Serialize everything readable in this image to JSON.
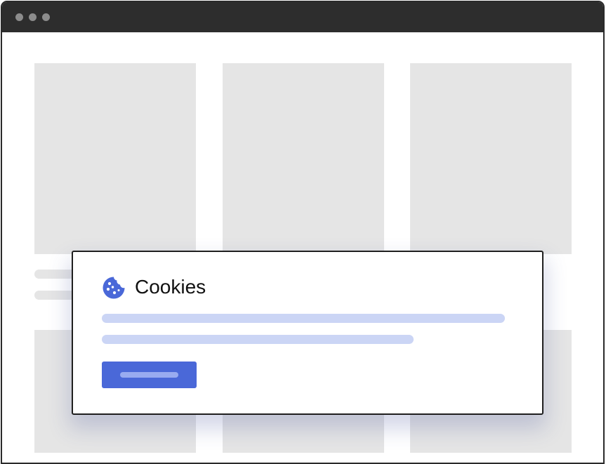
{
  "browser": {
    "titlebar_color": "#2d2d2d",
    "window_controls": [
      "window-control-dot",
      "window-control-dot",
      "window-control-dot"
    ]
  },
  "page": {
    "placeholder_color": "#e5e5e5"
  },
  "cookie_dialog": {
    "icon": "cookie-icon",
    "title": "Cookies",
    "accent_color": "#4a68d8",
    "text_placeholder_color": "#cbd5f5"
  }
}
